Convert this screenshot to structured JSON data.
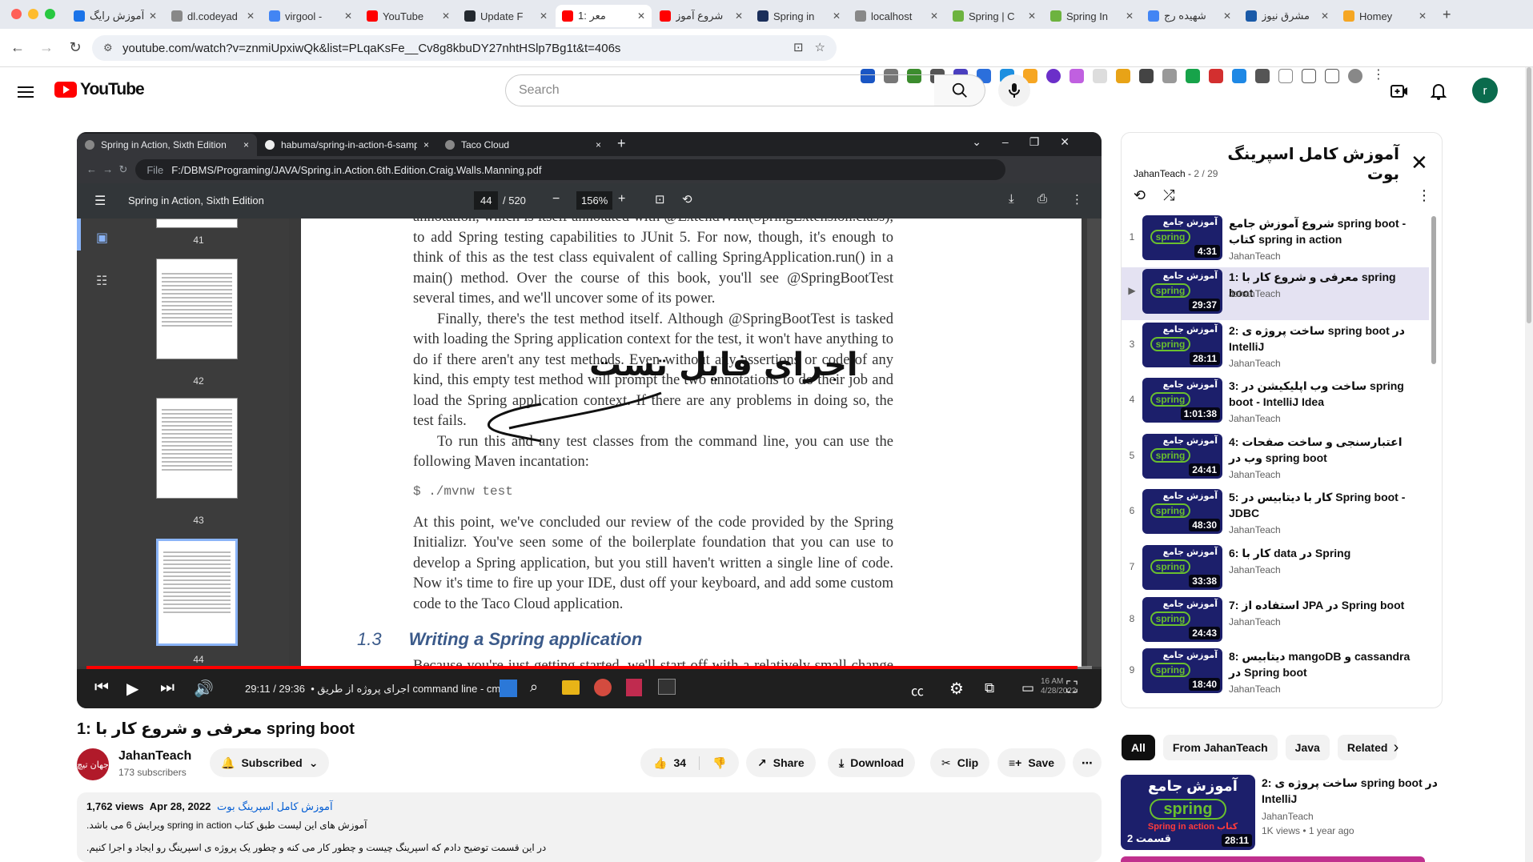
{
  "browser": {
    "tabs": [
      {
        "title": "آموزش رایگ",
        "color": "#1a73e8"
      },
      {
        "title": "dl.codeyad",
        "color": "#888888"
      },
      {
        "title": "virgool -",
        "color": "#4285f4"
      },
      {
        "title": "YouTube",
        "color": "#ff0000"
      },
      {
        "title": "Update F",
        "color": "#24292f"
      },
      {
        "title": "1: معر",
        "color": "#ff0000",
        "active": true
      },
      {
        "title": "شروع آموز",
        "color": "#ff0000"
      },
      {
        "title": "Spring in",
        "color": "#1a2e5a"
      },
      {
        "title": "localhost",
        "color": "#888888"
      },
      {
        "title": "Spring | C",
        "color": "#6db33f"
      },
      {
        "title": "Spring In",
        "color": "#6db33f"
      },
      {
        "title": "شهیده رج",
        "color": "#4285f4"
      },
      {
        "title": "مشرق نیوز",
        "color": "#1a5aa8"
      },
      {
        "title": "Homey",
        "color": "#f5a623"
      }
    ],
    "new_tab": "+",
    "url": "youtube.com/watch?v=znmiUpxiwQk&list=PLqaKsFe__Cv8g8kbuDY27nhtHSlp7Bg1t&t=406s"
  },
  "youtube": {
    "logo_text": "YouTube",
    "search_placeholder": "Search",
    "avatar_letter": "r"
  },
  "player": {
    "inner_tabs": [
      {
        "title": "Spring in Action, Sixth Edition",
        "active": true
      },
      {
        "title": "habuma/spring-in-action-6-samp"
      },
      {
        "title": "Taco Cloud"
      }
    ],
    "inner_new_tab": "+",
    "inner_url_label": "File",
    "inner_url": "F:/DBMS/Programing/JAVA/Spring.in.Action.6th.Edition.Craig.Walls.Manning.pdf",
    "pdf_title": "Spring in Action, Sixth Edition",
    "pdf_page": "44",
    "pdf_pages_total": "/ 520",
    "pdf_zoom": "156%",
    "thumb_numbers": [
      "41",
      "42",
      "43",
      "44"
    ],
    "doc": {
      "p1": "annotation, which is itself annotated with @ExtendWith(SpringExtension.class), to add Spring testing capabilities to JUnit 5. For now, though, it's enough to think of this as the test class equivalent of calling SpringApplication.run() in a main() method. Over the course of this book, you'll see @SpringBootTest several times, and we'll uncover some of its power.",
      "p2": "Finally, there's the test method itself. Although @SpringBootTest is tasked with loading the Spring application context for the test, it won't have anything to do if there aren't any test methods. Even without any assertions or code of any kind, this empty test method will prompt the two annotations to do their job and load the Spring application context. If there are any problems in doing so, the test fails.",
      "p3": "To run this and any test classes from the command line, you can use the following Maven incantation:",
      "code": "$ ./mvnw test",
      "p4": "At this point, we've concluded our review of the code provided by the Spring Initializr. You've seen some of the boilerplate foundation that you can use to develop a Spring application, but you still haven't written a single line of code. Now it's time to fire up your IDE, dust off your keyboard, and add some custom code to the Taco Cloud application.",
      "section_num": "1.3",
      "section_title": "Writing a Spring application",
      "p5": "Because you're just getting started, we'll start off with a relatively small change to the"
    },
    "annotation": "اجرای فایل تست",
    "time_current": "29:11",
    "time_total": "29:36",
    "chapter": "اجرای پروژه از طریق command line - cmd",
    "progress": 0.986,
    "tray_date": "16 AM",
    "tray_date2": "4/28/2022"
  },
  "video": {
    "title": "1: معرفی و شروع کار با spring boot",
    "channel": "JahanTeach",
    "channel_avatar_text": "جهان تیچ",
    "subscribers": "173 subscribers",
    "subscribe_label": "Subscribed",
    "likes": "34",
    "share_label": "Share",
    "download_label": "Download",
    "clip_label": "Clip",
    "save_label": "Save",
    "views": "1,762 views",
    "date": "Apr 28, 2022",
    "playlist_link": "آموزش کامل اسپرینگ بوت",
    "desc_line1": "آموزش های این لیست طبق کتاب spring in action ویرایش 6 می باشد.",
    "desc_line2": "در این قسمت توضیح دادم که اسپرینگ چیست و چطور کار می کنه و چطور یک پروژه ی اسپرینگ رو ایجاد و اجرا کنیم."
  },
  "playlist": {
    "title": "آموزش کامل اسپرینگ بوت",
    "channel": "JahanTeach",
    "position": "2 / 29",
    "thumb_text_top": "آموزش جامع",
    "thumb_text_mid": "spring",
    "items": [
      {
        "index": "1",
        "title": "شروع آموزش جامع spring boot - کتاب spring in action",
        "channel": "JahanTeach",
        "duration": "4:31"
      },
      {
        "index": "▶",
        "title": "1: معرفی و شروع کار با spring boot",
        "channel": "JahanTeach",
        "duration": "29:37",
        "selected": true
      },
      {
        "index": "3",
        "title": "2: ساخت پروژه ی spring boot در IntelliJ",
        "channel": "JahanTeach",
        "duration": "28:11"
      },
      {
        "index": "4",
        "title": "3: ساخت وب اپلیکیشن در spring boot - IntelliJ Idea",
        "channel": "JahanTeach",
        "duration": "1:01:38"
      },
      {
        "index": "5",
        "title": "4: اعتبارسنجی و ساخت صفحات وب در spring boot",
        "channel": "JahanTeach",
        "duration": "24:41"
      },
      {
        "index": "6",
        "title": "5: کار با دیتابیس در Spring boot - JDBC",
        "channel": "JahanTeach",
        "duration": "48:30"
      },
      {
        "index": "7",
        "title": "6: کار با data در Spring",
        "channel": "JahanTeach",
        "duration": "33:38"
      },
      {
        "index": "8",
        "title": "7: استفاده از JPA در Spring boot",
        "channel": "JahanTeach",
        "duration": "24:43"
      },
      {
        "index": "9",
        "title": "8: دیتابیس mangoDB و cassandra در Spring boot",
        "channel": "JahanTeach",
        "duration": "18:40"
      }
    ]
  },
  "chips": [
    "All",
    "From JahanTeach",
    "Java",
    "Related"
  ],
  "recommended": {
    "title": "2: ساخت پروژه ی spring boot در IntelliJ",
    "channel": "JahanTeach",
    "meta": "1K views  •  1 year ago",
    "thumb_top": "آموزش جامع",
    "thumb_mid": "spring",
    "thumb_sub": "Spring in action کتاب",
    "thumb_part": "قسمت 2",
    "duration": "28:11"
  },
  "colors": {
    "youtube_red": "#ff0000",
    "spring_green": "#6db33f",
    "thumb_bg": "#1c1f6b",
    "playlist_selected": "#e4e2f2"
  }
}
